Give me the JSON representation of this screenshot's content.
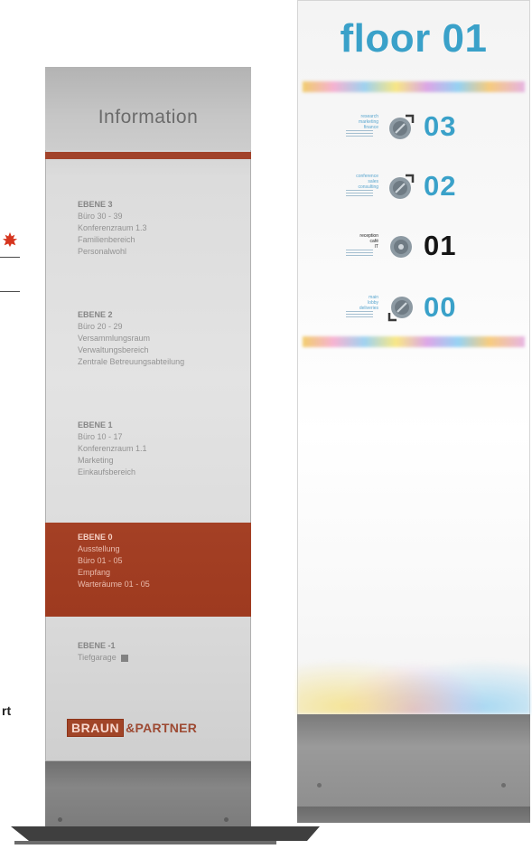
{
  "left_fragment": {
    "text": "rt"
  },
  "info_sign": {
    "title": "Information",
    "levels": [
      {
        "heading": "EBENE 3",
        "lines": [
          "Büro 30 - 39",
          "Konferenzraum 1.3",
          "Familienbereich",
          "Personalwohl"
        ]
      },
      {
        "heading": "EBENE 2",
        "lines": [
          "Büro 20 - 29",
          "Versammlungsraum",
          "Verwaltungsbereich",
          "Zentrale Betreuungsabteilung"
        ]
      },
      {
        "heading": "EBENE 1",
        "lines": [
          "Büro 10 - 17",
          "Konferenzraum 1.1",
          "Marketing",
          "Einkaufsbereich"
        ]
      }
    ],
    "current_level": {
      "heading": "EBENE 0",
      "lines": [
        "Ausstellung",
        "Büro 01 - 05",
        "Empfang",
        "Warteräume 01 - 05"
      ]
    },
    "basement": {
      "heading": "EBENE -1",
      "lines": [
        "Tiefgarage"
      ]
    },
    "brand_box": "BRAUN",
    "brand_rest": "&PARTNER",
    "colors": {
      "accent": "#a2432b"
    }
  },
  "floor_sign": {
    "title": "floor 01",
    "floors": [
      {
        "number": "03",
        "state": "up",
        "desc": [
          "research",
          "marketing",
          "finance"
        ]
      },
      {
        "number": "02",
        "state": "up",
        "desc": [
          "conference",
          "sales",
          "consulting"
        ]
      },
      {
        "number": "01",
        "state": "current",
        "desc": [
          "reception",
          "café",
          "IT"
        ]
      },
      {
        "number": "00",
        "state": "down",
        "desc": [
          "main",
          "lobby",
          "deliveries"
        ]
      }
    ],
    "colors": {
      "accent": "#3aa1c9",
      "current": "#151515"
    }
  }
}
